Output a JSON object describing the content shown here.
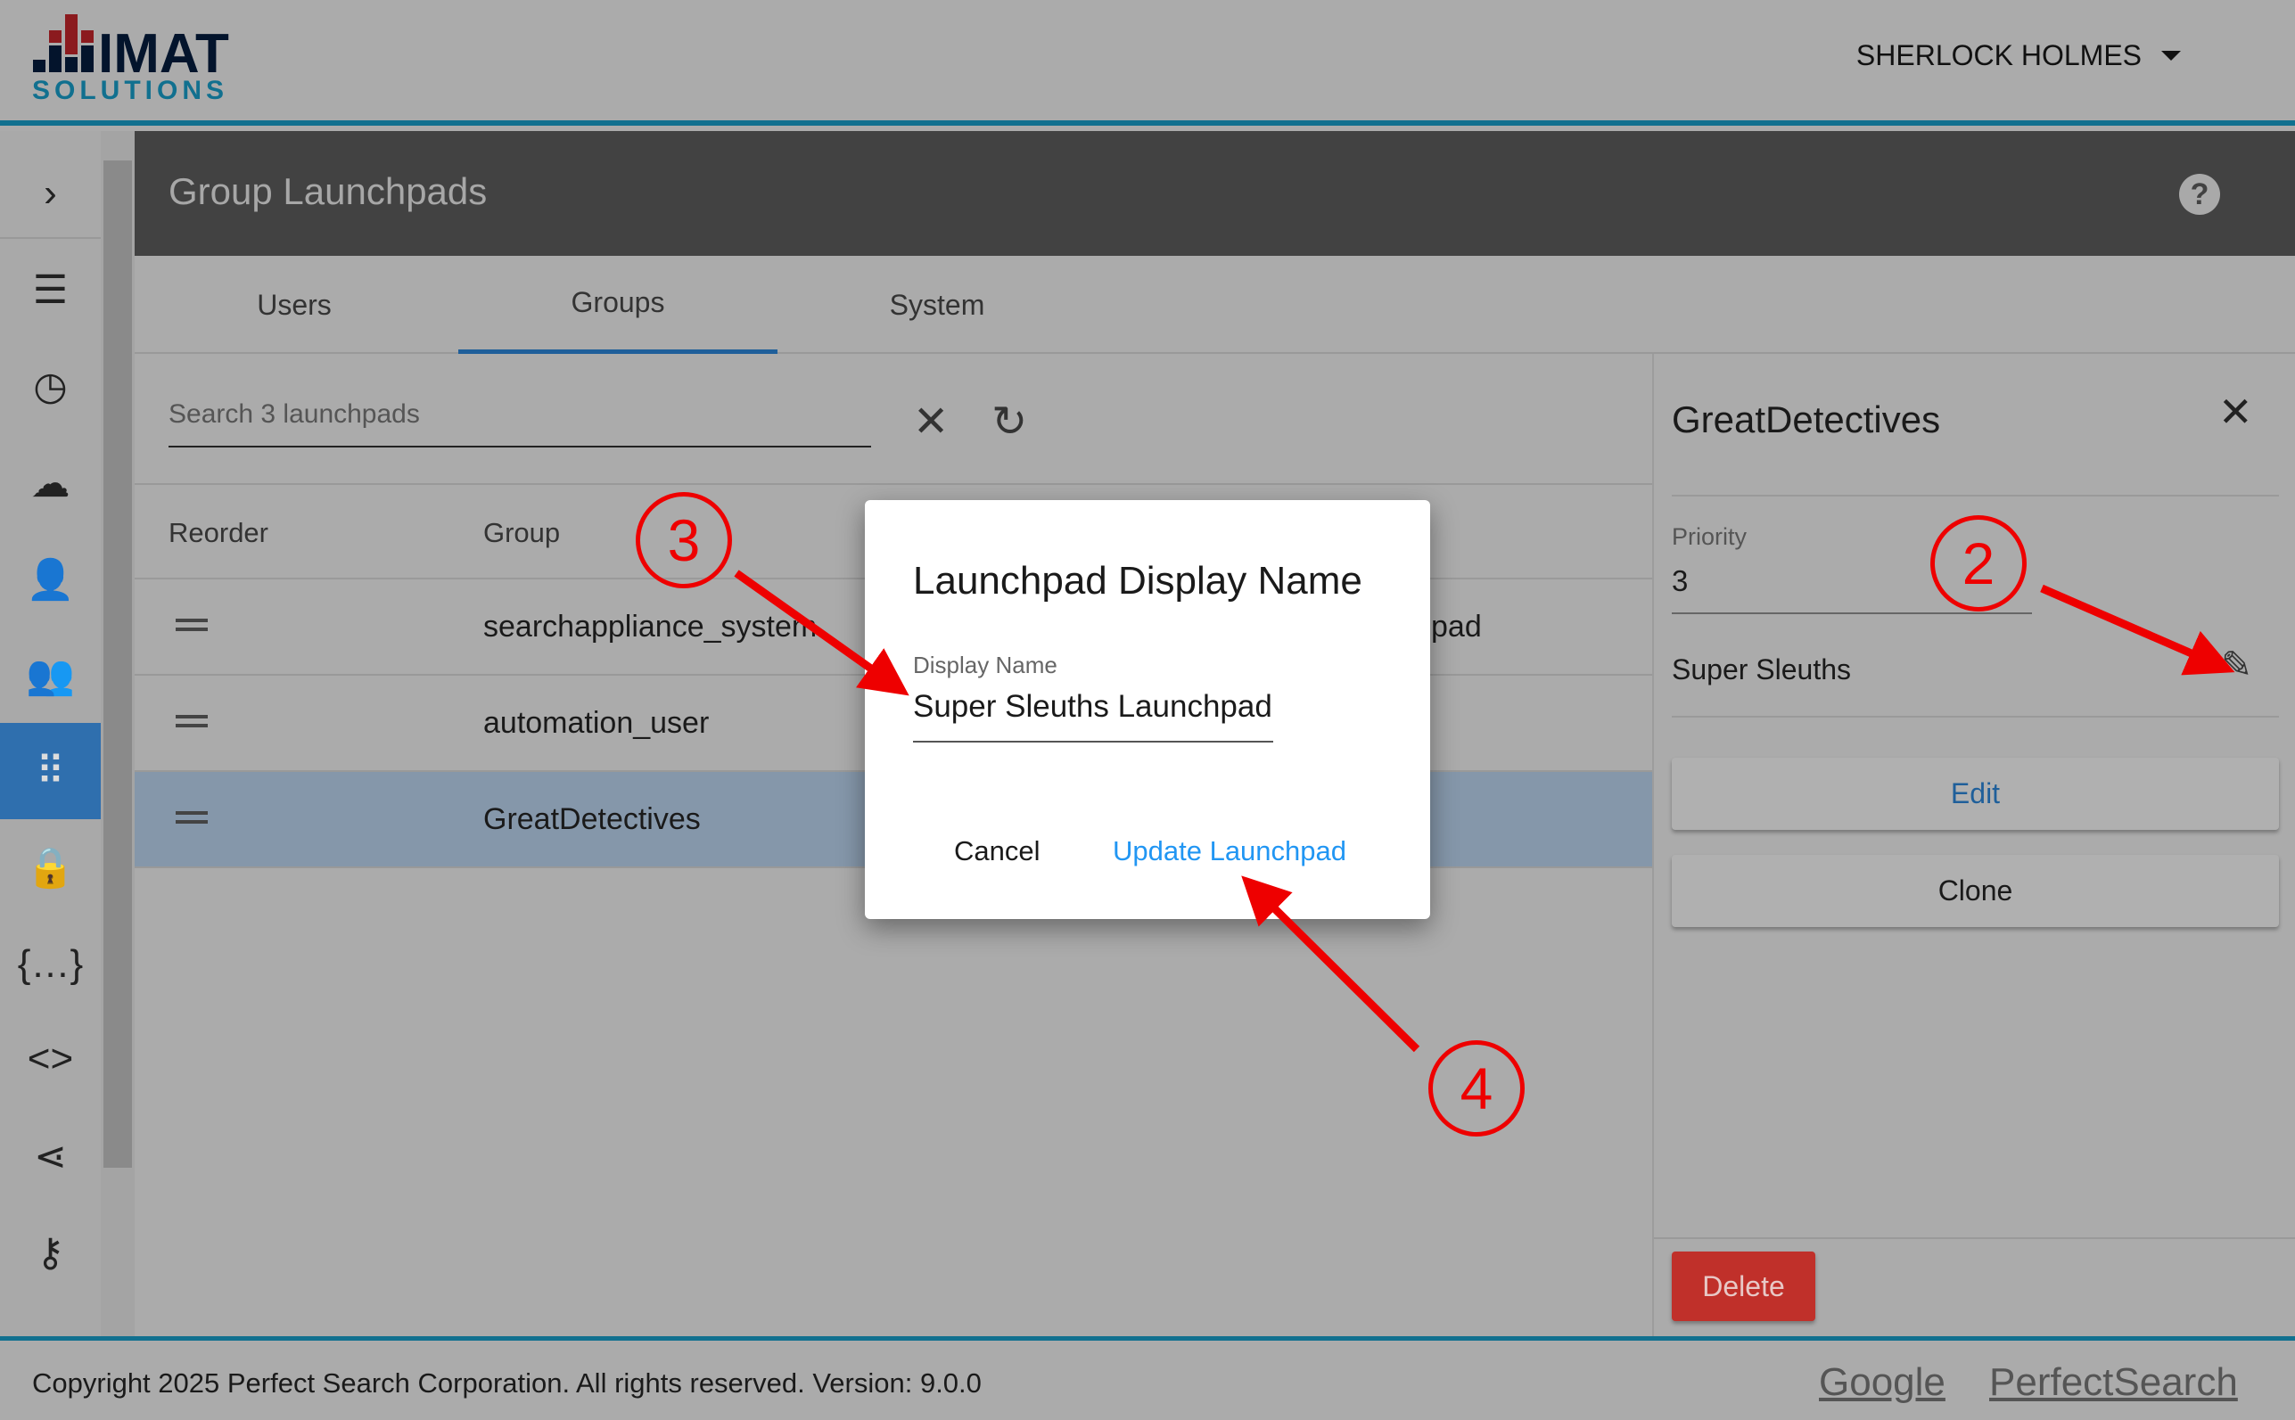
{
  "header": {
    "logo_text": "IMAT SOLUTIONS",
    "user_name": "SHERLOCK HOLMES"
  },
  "page": {
    "title": "Group Launchpads"
  },
  "tabs": [
    {
      "label": "Users"
    },
    {
      "label": "Groups",
      "active": true
    },
    {
      "label": "System"
    }
  ],
  "search": {
    "placeholder": "Search 3 launchpads"
  },
  "table": {
    "headers": [
      "Reorder",
      "Group"
    ],
    "rows": [
      {
        "group": "searchappliance_system",
        "extra": "pad"
      },
      {
        "group": "automation_user",
        "extra": ""
      },
      {
        "group": "GreatDetectives",
        "extra": "",
        "selected": true
      }
    ]
  },
  "panel": {
    "title": "GreatDetectives",
    "priority_label": "Priority",
    "priority_value": "3",
    "display_name": "Super Sleuths",
    "edit_label": "Edit",
    "clone_label": "Clone",
    "delete_label": "Delete"
  },
  "dialog": {
    "title": "Launchpad Display Name",
    "field_label": "Display Name",
    "field_value": "Super Sleuths Launchpad",
    "cancel_label": "Cancel",
    "update_label": "Update Launchpad"
  },
  "annotations": [
    "2",
    "3",
    "4"
  ],
  "footer": {
    "copyright": "Copyright 2025 Perfect Search Corporation. All rights reserved. Version: 9.0.0",
    "links": [
      "Google",
      "PerfectSearch"
    ]
  },
  "colors": {
    "accent": "#2196f3",
    "brand_blue": "#11708f",
    "brand_red": "#8b1a1e",
    "delete": "#c0302a",
    "annotation": "#e00000"
  }
}
